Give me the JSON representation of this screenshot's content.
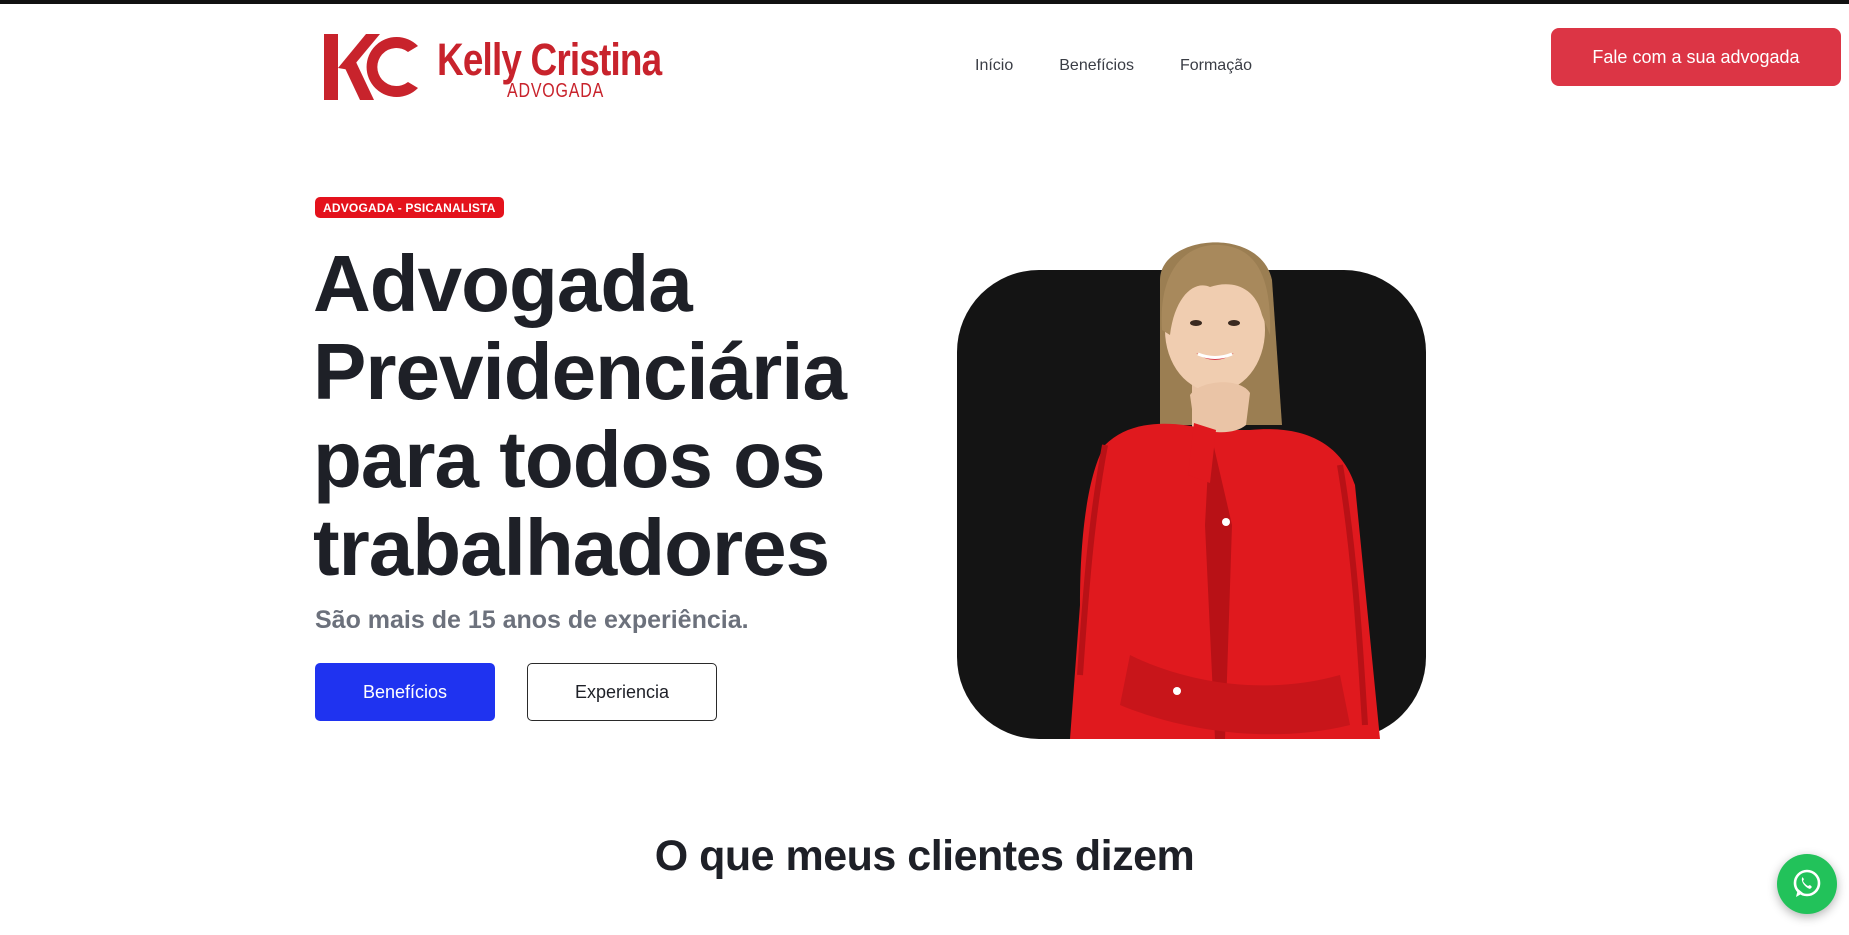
{
  "header": {
    "logo": {
      "initials": "KC",
      "name": "Kelly Cristina",
      "subtitle": "ADVOGADA"
    },
    "nav": [
      {
        "label": "Início"
      },
      {
        "label": "Benefícios"
      },
      {
        "label": "Formação"
      }
    ],
    "cta_label": "Fale com a sua advogada"
  },
  "hero": {
    "badge": "ADVOGADA - PSICANALISTA",
    "title_lines": [
      "Advogada",
      "Previdenciária",
      "para todos os",
      "trabalhadores"
    ],
    "subtitle": "São mais de 15 anos de experiência.",
    "primary_button": "Benefícios",
    "secondary_button": "Experiencia"
  },
  "testimonials": {
    "title": "O que meus clientes dizem"
  },
  "icons": {
    "whatsapp": "whatsapp-icon",
    "logo_mark": "kc-monogram-icon"
  },
  "colors": {
    "brand_red": "#c8232c",
    "cta_red": "#dc3545",
    "badge_red": "#e4121c",
    "primary_blue": "#1f33f0",
    "whatsapp_green": "#22c25a"
  }
}
